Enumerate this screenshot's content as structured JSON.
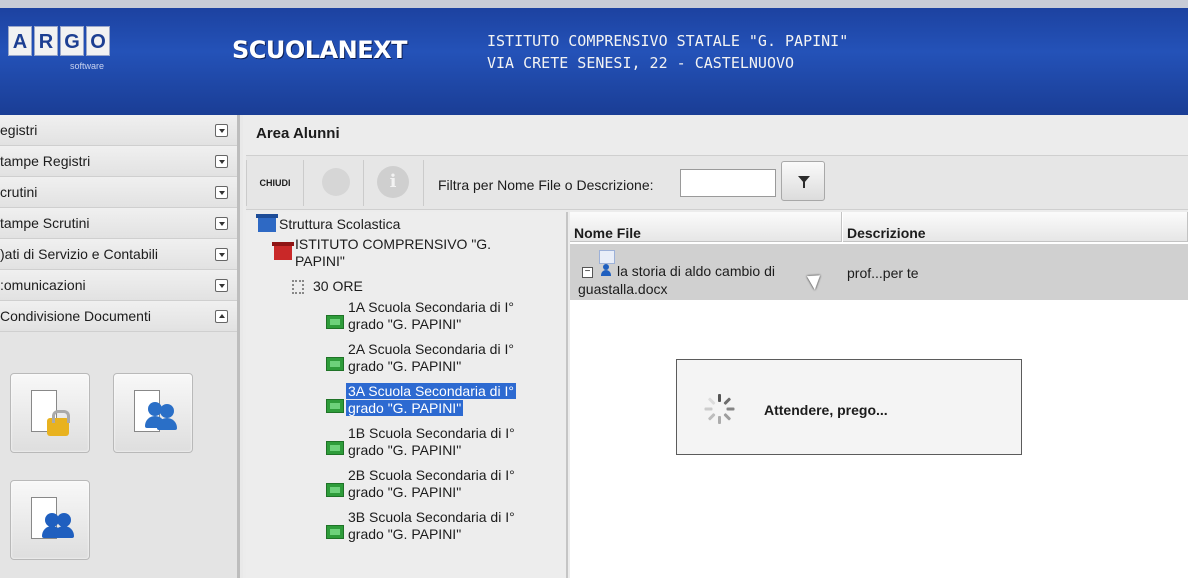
{
  "header": {
    "logo_letters": [
      "A",
      "R",
      "G",
      "O"
    ],
    "logo_sub": "software",
    "app_name": "SCUOLANEXT",
    "school_name": "ISTITUTO COMPRENSIVO STATALE \"G. PAPINI\"",
    "school_address": "VIA CRETE SENESI, 22 - CASTELNUOVO"
  },
  "sidebar": {
    "items": [
      {
        "label": "egistri"
      },
      {
        "label": "tampe Registri"
      },
      {
        "label": "crutini"
      },
      {
        "label": "tampe Scrutini"
      },
      {
        "label": ")ati di Servizio e Contabili"
      },
      {
        "label": ":omunicazioni"
      },
      {
        "label": "Condivisione Documenti"
      }
    ]
  },
  "main": {
    "title": "Area Alunni",
    "toolbar": {
      "close_label": "CHIUDI",
      "info_glyph": "i",
      "filter_label": "Filtra per Nome File o Descrizione:",
      "filter_value": ""
    },
    "tree": {
      "root": "Struttura Scolastica",
      "institute_line1": "ISTITUTO COMPRENSIVO \"G.",
      "institute_line2": "PAPINI\"",
      "hours": "30 ORE",
      "classes": [
        {
          "line1": "1A Scuola Secondaria di I°",
          "line2": "grado \"G. PAPINI\""
        },
        {
          "line1": "2A Scuola Secondaria di I°",
          "line2": "grado \"G. PAPINI\""
        },
        {
          "line1": "3A Scuola Secondaria di I°",
          "line2": "grado \"G. PAPINI\""
        },
        {
          "line1": "1B Scuola Secondaria di I°",
          "line2": "grado \"G. PAPINI\""
        },
        {
          "line1": "2B Scuola Secondaria di I°",
          "line2": "grado \"G. PAPINI\""
        },
        {
          "line1": "3B Scuola Secondaria di I°",
          "line2": "grado \"G. PAPINI\""
        }
      ]
    },
    "table": {
      "columns": [
        "Nome File",
        "Descrizione"
      ],
      "rows": [
        {
          "file_line1": "la storia di aldo cambio di",
          "file_line2": "guastalla.docx",
          "description": "prof...per te"
        }
      ]
    },
    "loading_text": "Attendere, prego..."
  }
}
